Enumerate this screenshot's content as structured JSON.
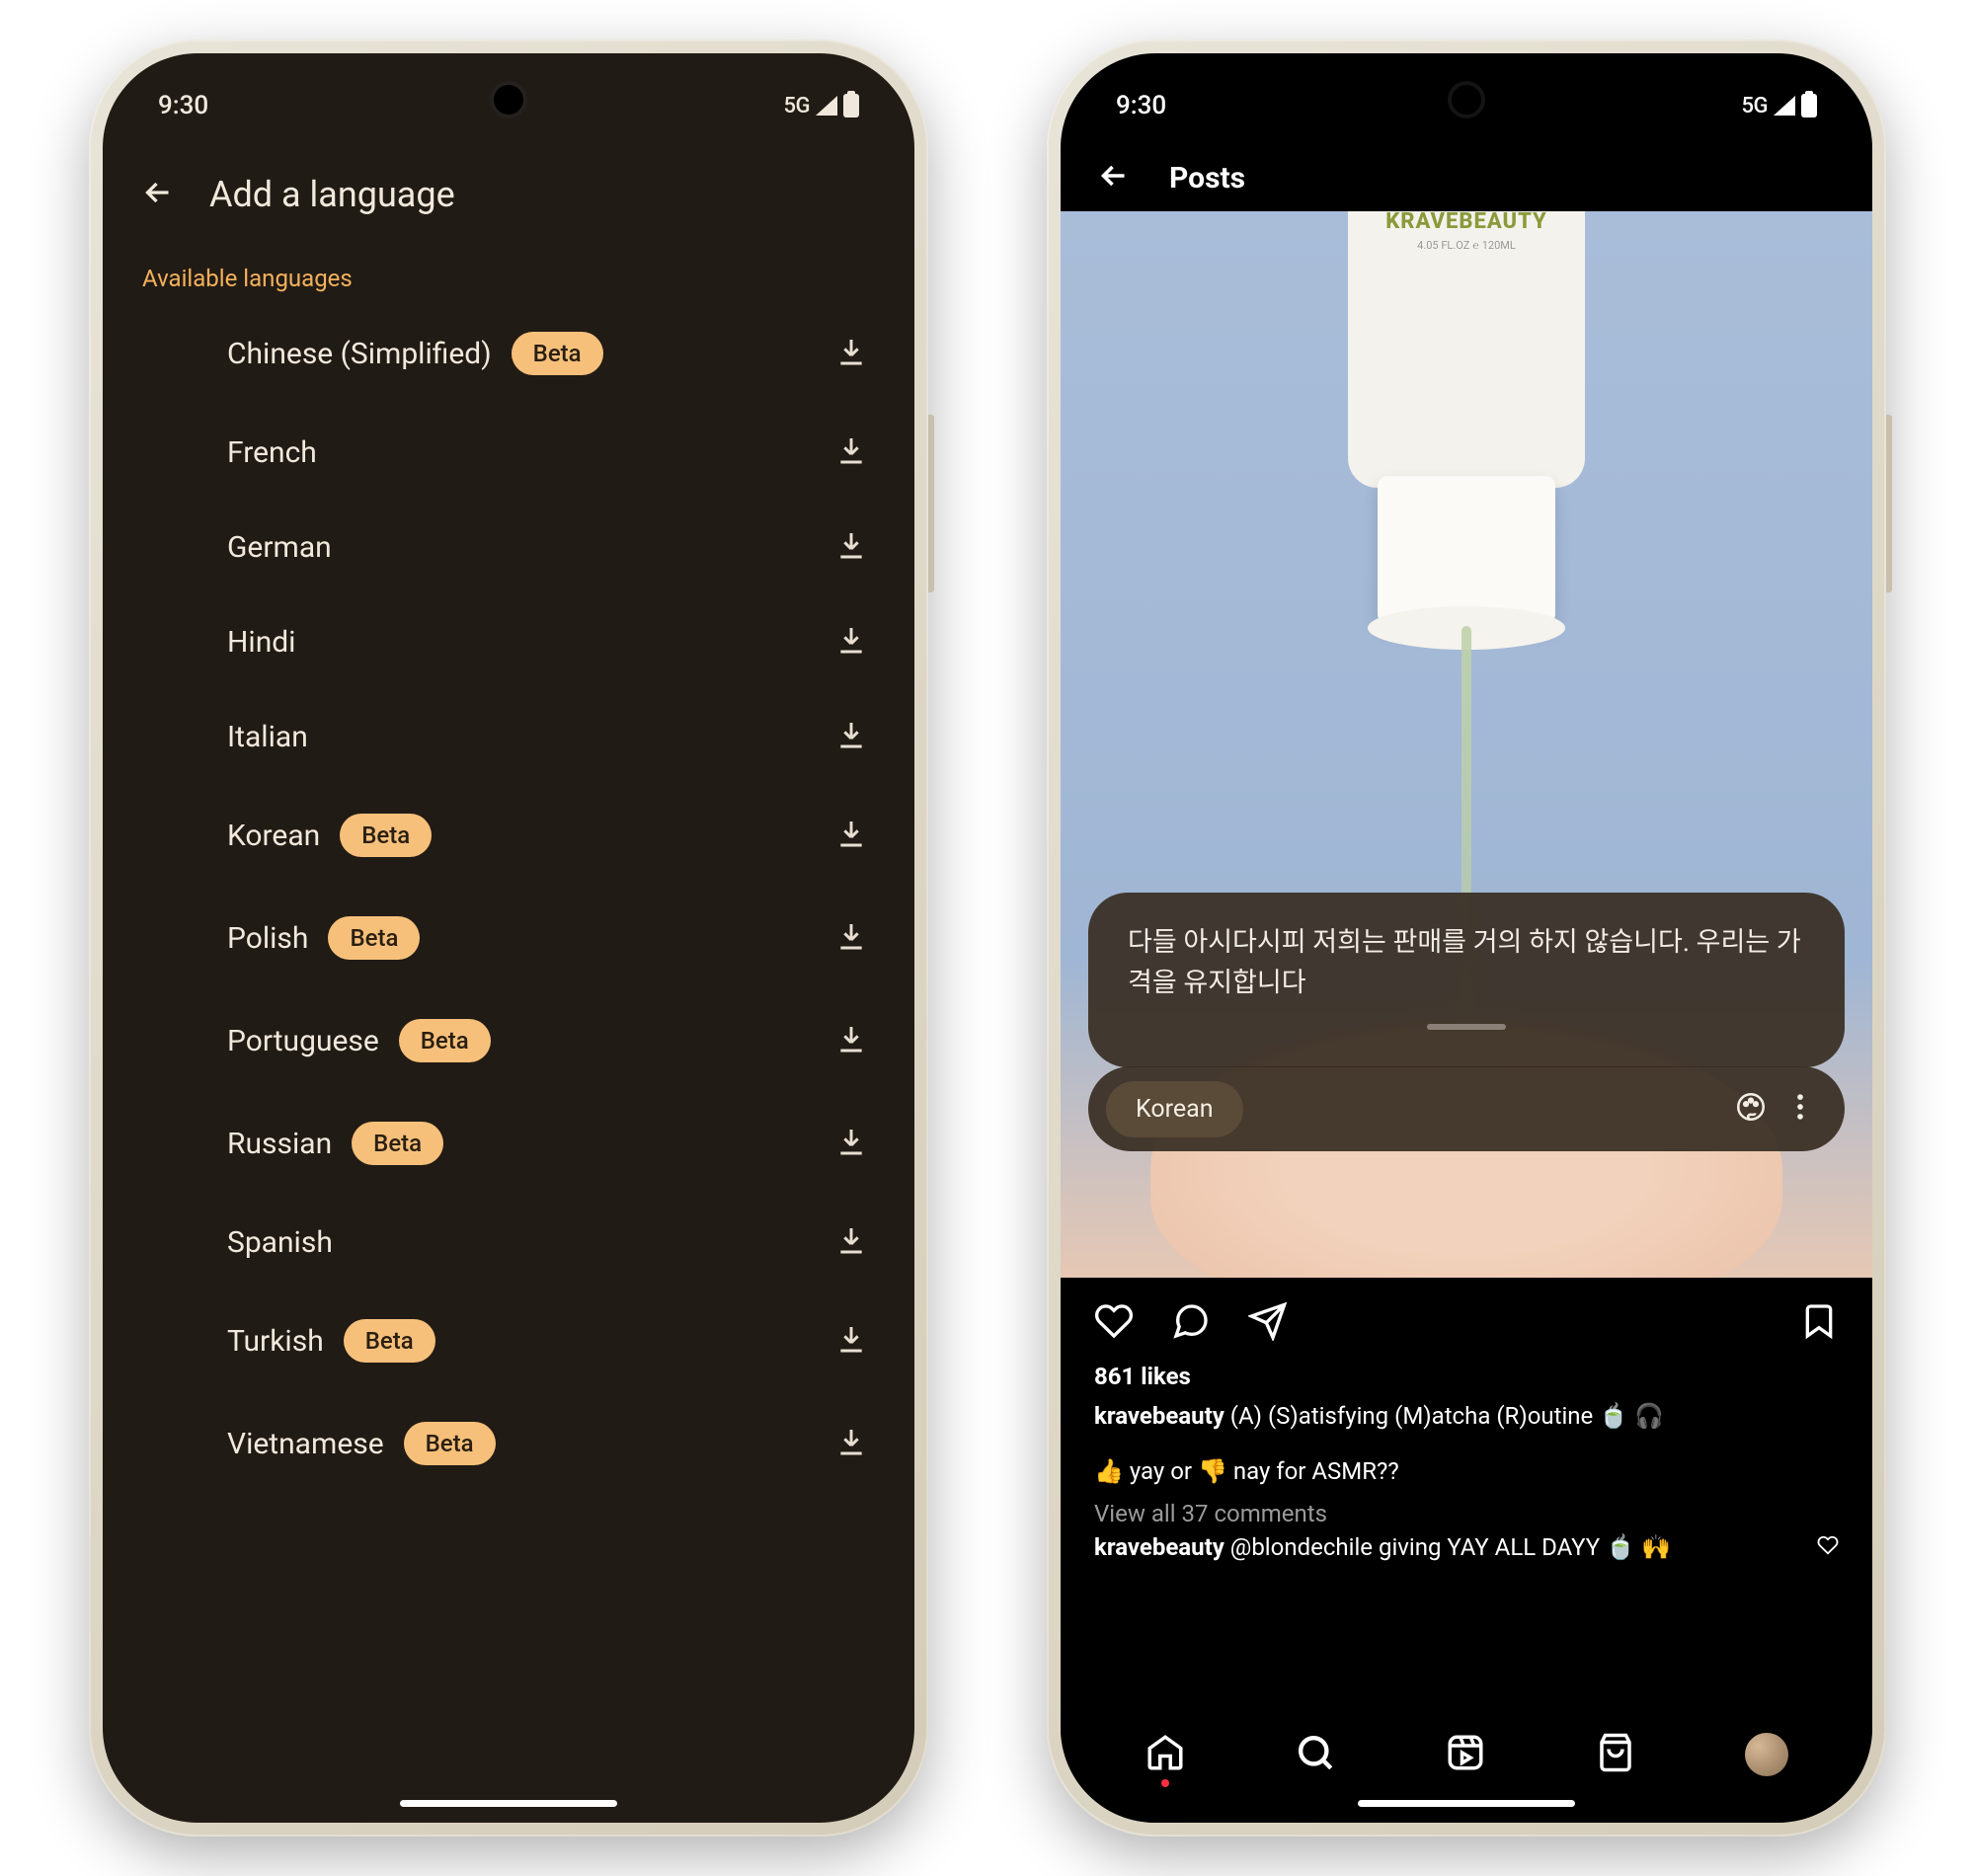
{
  "status": {
    "time": "9:30",
    "network": "5G"
  },
  "left": {
    "title": "Add a language",
    "section": "Available languages",
    "languages": [
      {
        "name": "Chinese (Simplified)",
        "beta": true
      },
      {
        "name": "French",
        "beta": false
      },
      {
        "name": "German",
        "beta": false
      },
      {
        "name": "Hindi",
        "beta": false
      },
      {
        "name": "Italian",
        "beta": false
      },
      {
        "name": "Korean",
        "beta": true
      },
      {
        "name": "Polish",
        "beta": true
      },
      {
        "name": "Portuguese",
        "beta": true
      },
      {
        "name": "Russian",
        "beta": true
      },
      {
        "name": "Spanish",
        "beta": false
      },
      {
        "name": "Turkish",
        "beta": true
      },
      {
        "name": "Vietnamese",
        "beta": true
      }
    ],
    "beta_label": "Beta"
  },
  "right": {
    "header": "Posts",
    "brand": "KRAVEBEAUTY",
    "brand_sub": "4.05 FL.OZ ℮ 120ML",
    "translation": "다들 아시다시피 저희는 판매를 거의 하지 않습니다. 우리는 가격을 유지합니다",
    "language_chip": "Korean",
    "likes": "861 likes",
    "caption_user": "kravebeauty",
    "caption_text": " (A) (S)atisfying (M)atcha (R)outine 🍵 🎧",
    "caption_line2": "👍 yay or 👎 nay for ASMR??",
    "view_comments": "View all 37 comments",
    "comment_user": "kravebeauty",
    "comment_text": " @blondechile giving YAY ALL DAYY 🍵 🙌"
  }
}
